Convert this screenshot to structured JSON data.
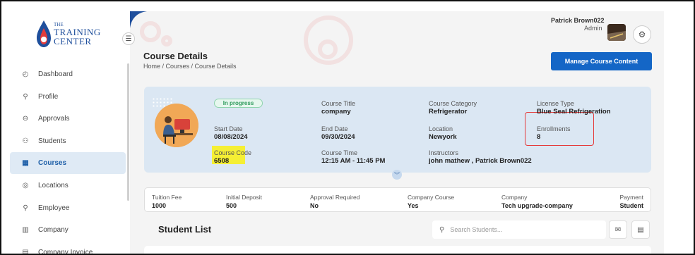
{
  "brand": {
    "line1": "THE",
    "line2": "TRAINING",
    "line3": "CENTER"
  },
  "sidebar": {
    "items": [
      {
        "label": "Dashboard",
        "icon": "dashboard-icon",
        "glyph": "◴",
        "active": false
      },
      {
        "label": "Profile",
        "icon": "user-icon",
        "glyph": "⚲",
        "active": false
      },
      {
        "label": "Approvals",
        "icon": "approvals-icon",
        "glyph": "⊖",
        "active": false
      },
      {
        "label": "Students",
        "icon": "students-icon",
        "glyph": "⚇",
        "active": false
      },
      {
        "label": "Courses",
        "icon": "courses-icon",
        "glyph": "▦",
        "active": true
      },
      {
        "label": "Locations",
        "icon": "location-icon",
        "glyph": "◎",
        "active": false
      },
      {
        "label": "Employee",
        "icon": "employee-icon",
        "glyph": "⚲",
        "active": false
      },
      {
        "label": "Company",
        "icon": "company-icon",
        "glyph": "▥",
        "active": false
      },
      {
        "label": "Company Invoice",
        "icon": "invoice-icon",
        "glyph": "▤",
        "active": false
      }
    ]
  },
  "header": {
    "user_name": "Patrick Brown022",
    "user_role": "Admin"
  },
  "page": {
    "title": "Course Details",
    "breadcrumb": "Home / Courses / Course Details",
    "manage_button": "Manage Course Content"
  },
  "course": {
    "status": "In progress",
    "start_date_label": "Start Date",
    "start_date": "08/08/2024",
    "course_code_label": "Course Code",
    "course_code": "6508",
    "course_title_label": "Course Title",
    "course_title": "company",
    "end_date_label": "End Date",
    "end_date": "09/30/2024",
    "course_time_label": "Course Time",
    "course_time": "12:15 AM - 11:45 PM",
    "category_label": "Course Category",
    "category": "Refrigerator",
    "location_label": "Location",
    "location": "Newyork",
    "instructors_label": "Instructors",
    "instructors": "john mathew , Patrick Brown022",
    "license_label": "License Type",
    "license": "Blue Seal Refrigeration",
    "enrollments_label": "Enrollments",
    "enrollments": "8"
  },
  "fees": {
    "tuition_label": "Tuition Fee",
    "tuition": "1000",
    "deposit_label": "Initial Deposit",
    "deposit": "500",
    "approval_label": "Approval Required",
    "approval": "No",
    "company_course_label": "Company Course",
    "company_course": "Yes",
    "company_label": "Company",
    "company": "Tech upgrade-company",
    "payment_label": "Payment",
    "payment": "Student"
  },
  "students": {
    "title": "Student List",
    "search_placeholder": "Search Students..."
  },
  "colors": {
    "accent": "#1466c6",
    "card_bg": "#dbe7f3",
    "highlight": "#f5ef34",
    "annotation": "#e53b3b",
    "status": "#2d9a5b"
  }
}
